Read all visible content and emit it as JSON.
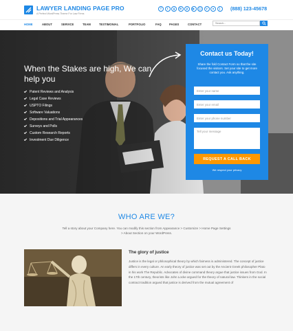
{
  "header": {
    "title": "LAWYER LANDING PAGE PRO",
    "tagline": "A Perfect WordPress Theme For Law Firms",
    "phone": "(888) 123-45678",
    "social_icons": [
      "facebook-icon",
      "twitter-icon",
      "google-plus-icon",
      "linkedin-icon",
      "pinterest-icon",
      "youtube-icon",
      "instagram-icon",
      "vimeo-icon",
      "dribbble-icon",
      "rss-icon"
    ],
    "brand_color": "#1e88e5"
  },
  "nav": {
    "items": [
      "HOME",
      "ABOUT",
      "SERVICE",
      "TEAM",
      "TESTIMONIAL",
      "PORTFOLIO",
      "FAQ",
      "PAGES",
      "CONTACT"
    ],
    "active": "HOME",
    "search_placeholder": "Search..."
  },
  "hero": {
    "title": "When the Stakes are high, We can help you",
    "bullets": [
      "Patent Reviews and Analysis",
      "Legal Case Reviews",
      "USPTO Filings",
      "Software Valuations",
      "Depositions and Trial Appearances",
      "Surveys and Polls",
      "Custom Research Reports",
      "Investment Due Diligence"
    ]
  },
  "contact": {
    "title": "Contact us Today!",
    "description": "Share the fold Contact Form so that the site focused the visitors. Set your site to get more contact you. Ask anything.",
    "name_placeholder": "Enter your name",
    "email_placeholder": "Enter your email",
    "phone_placeholder": "Enter your phone number",
    "message_placeholder": "Tell your message",
    "button": "REQUEST A CALL BACK",
    "privacy": "We respect your privacy",
    "accent_color": "#ff9800"
  },
  "who": {
    "title": "WHO ARE WE?",
    "description": "Tell a story about your Company here. You can modify this section from Appearance > Customize > Home Page Settings > About Section on your WordPress.",
    "item_title": "The glory of justice",
    "item_text": "Justice is the legal or philosophical theory by which fairness is administered. The concept of justice differs in every culture. An early theory of justice was set out by the Ancient Greek philosopher Plato in his work The Republic. Advocates of divine command theory argue that justice issues from God. In the 17th century, theorists like John Locke argued for the theory of natural law. Thinkers in the social contract tradition argued that justice is derived from the mutual agreement of"
  }
}
